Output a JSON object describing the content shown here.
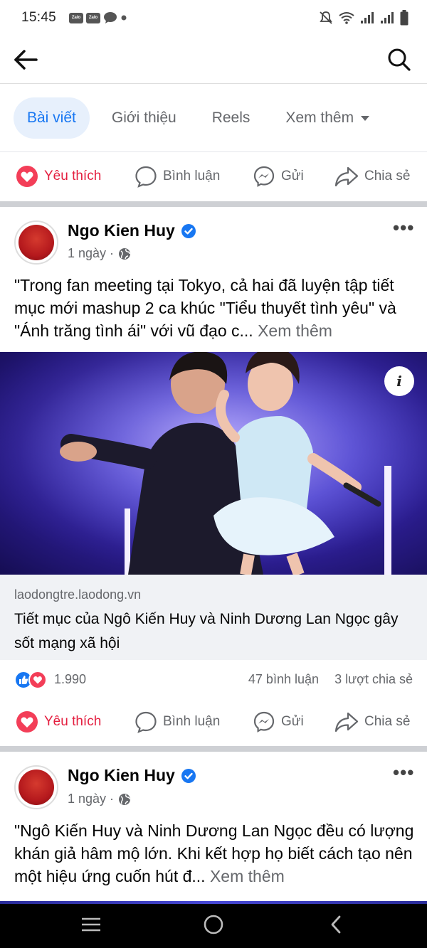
{
  "status_bar": {
    "time": "15:45",
    "zalo_label": "Zalo"
  },
  "tabs": [
    {
      "label": "Bài viết"
    },
    {
      "label": "Giới thiệu"
    },
    {
      "label": "Reels"
    },
    {
      "label": "Xem thêm"
    }
  ],
  "actions": {
    "like": "Yêu thích",
    "comment": "Bình luận",
    "send": "Gửi",
    "share": "Chia sẻ"
  },
  "posts": [
    {
      "author": "Ngo Kien Huy",
      "time": "1 ngày ·",
      "text": "\"Trong fan meeting tại Tokyo, cả hai đã luyện tập tiết mục mới mashup 2 ca khúc \"Tiểu thuyết tình yêu\" và \"Ánh trăng tình ái\" với vũ đạo c...",
      "see_more": "Xem thêm",
      "link_domain": "laodongtre.laodong.vn",
      "link_title": "Tiết mục của Ngô Kiến Huy và Ninh Dương Lan Ngọc gây sốt mạng xã hội",
      "reactions": "1.990",
      "comments": "47 bình luận",
      "shares": "3 lượt chia sẻ"
    },
    {
      "author": "Ngo Kien Huy",
      "time": "1 ngày ·",
      "text": "\"Ngô Kiến Huy và Ninh Dương Lan Ngọc đều có lượng khán giả hâm mộ lớn. Khi kết hợp họ biết cách tạo nên một hiệu ứng cuốn hút đ...",
      "see_more": "Xem thêm"
    }
  ],
  "colors": {
    "accent": "#1877f2",
    "like_red": "#e41e3f",
    "secondary_text": "#65676b",
    "tab_active_bg": "#e7f0fc"
  },
  "icons": [
    "back-arrow-icon",
    "search-icon",
    "heart-icon",
    "comment-icon",
    "messenger-icon",
    "share-icon",
    "verified-icon",
    "globe-icon",
    "more-icon",
    "info-icon"
  ]
}
